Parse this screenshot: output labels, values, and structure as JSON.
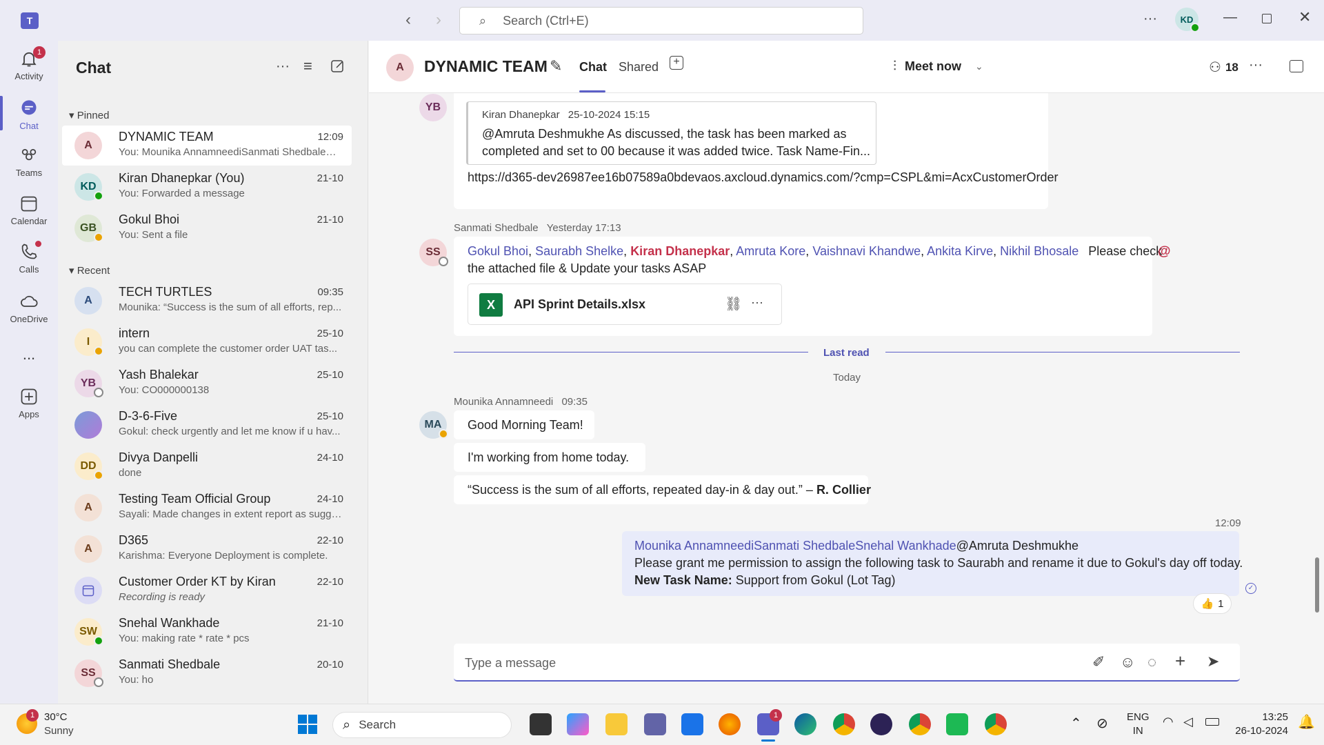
{
  "titlebar": {
    "search_placeholder": "Search (Ctrl+E)",
    "user_initials": "KD"
  },
  "rail": [
    {
      "label": "Activity",
      "badge": "1"
    },
    {
      "label": "Chat"
    },
    {
      "label": "Teams"
    },
    {
      "label": "Calendar"
    },
    {
      "label": "Calls"
    },
    {
      "label": "OneDrive"
    },
    {
      "label": "..."
    },
    {
      "label": "Apps"
    }
  ],
  "list": {
    "title": "Chat",
    "pinned_label": "Pinned",
    "recent_label": "Recent",
    "pinned": [
      {
        "initials": "A",
        "name": "DYNAMIC TEAM",
        "time": "12:09",
        "preview": "You: Mounika AnnamneediSanmati ShedbaleSn..."
      },
      {
        "initials": "KD",
        "name": "Kiran Dhanepkar (You)",
        "time": "21-10",
        "preview": "You: Forwarded a message"
      },
      {
        "initials": "GB",
        "name": "Gokul Bhoi",
        "time": "21-10",
        "preview": "You: Sent a file"
      }
    ],
    "recent": [
      {
        "initials": "A",
        "name": "TECH TURTLES",
        "time": "09:35",
        "preview": "Mounika: “Success is the sum of all efforts, rep..."
      },
      {
        "initials": "I",
        "name": "intern",
        "time": "25-10",
        "preview": "you can complete the customer order UAT  tas..."
      },
      {
        "initials": "YB",
        "name": "Yash Bhalekar",
        "time": "25-10",
        "preview": "You: CO000000138"
      },
      {
        "initials": "",
        "name": "D-3-6-Five",
        "time": "25-10",
        "preview": "Gokul: check urgently and let me know if u hav..."
      },
      {
        "initials": "DD",
        "name": "Divya Danpelli",
        "time": "24-10",
        "preview": "done"
      },
      {
        "initials": "A",
        "name": "Testing Team Official Group",
        "time": "24-10",
        "preview": "Sayali: Made changes in extent report as sugge..."
      },
      {
        "initials": "A",
        "name": "D365",
        "time": "22-10",
        "preview": "Karishma: Everyone  Deployment is complete."
      },
      {
        "initials": "",
        "name": "Customer Order KT by Kiran",
        "time": "22-10",
        "preview": "Recording is ready"
      },
      {
        "initials": "SW",
        "name": "Snehal Wankhade",
        "time": "21-10",
        "preview": "You: making rate  * rate * pcs"
      },
      {
        "initials": "SS",
        "name": "Sanmati Shedbale",
        "time": "20-10",
        "preview": "You: ho"
      }
    ]
  },
  "header": {
    "avatar": "A",
    "title": "DYNAMIC TEAM",
    "tab_chat": "Chat",
    "tab_shared": "Shared",
    "meet_now": "Meet now",
    "participants": "18"
  },
  "messages": {
    "quote_author": "Kiran Dhanepkar",
    "quote_time": "25-10-2024 15:15",
    "quote_text1": "@Amruta Deshmukhe As discussed, the task has been marked as",
    "quote_text2": "completed and set to 00 because it was added twice. Task Name-Fin...",
    "yb_link": "https://d365-dev26987ee16b07589a0bdevaos.axcloud.dynamics.com/?cmp=CSPL&mi=AcxCustomerOrder",
    "yb_initials": "YB",
    "ss_author": "Sanmati Shedbale",
    "ss_time": "Yesterday 17:13",
    "ss_initials": "SS",
    "ss_m1": "Gokul Bhoi",
    "ss_m2": "Saurabh Shelke",
    "ss_m3": "Kiran Dhanepkar",
    "ss_m4": "Amruta Kore",
    "ss_m5": "Vaishnavi Khandwe",
    "ss_m6": "Ankita Kirve",
    "ss_m7": "Nikhil Bhosale",
    "ss_text1": "Please check",
    "ss_text2": "the attached file & Update your tasks ASAP",
    "file_name": "API Sprint Details.xlsx",
    "last_read": "Last read",
    "today": "Today",
    "mo_author": "Mounika Annamneedi",
    "mo_time": "09:35",
    "mo_initials": "MA",
    "mo_m1": "Good Morning Team!",
    "mo_m2": "I'm working from home today.",
    "mo_m3": "“Success is the sum of all efforts, repeated day-in & day out.” –",
    "mo_m3b": "R. Collier",
    "my_time": "12:09",
    "my_line1_mentions": "Mounika AnnamneediSanmati ShedbaleSnehal Wankhade",
    "my_line1_rest": "@Amruta Deshmukhe",
    "my_line2": "Please grant me permission to assign the following task to Saurabh and rename it due to Gokul's day off today.",
    "my_line3_label": "New Task Name:",
    "my_line3_value": "Support from Gokul (Lot Tag)",
    "reaction_count": "1"
  },
  "compose": {
    "placeholder": "Type a message"
  },
  "taskbar": {
    "temp": "30°C",
    "weather": "Sunny",
    "weather_badge": "1",
    "search": "Search",
    "lang1": "ENG",
    "lang2": "IN",
    "time": "13:25",
    "date": "26-10-2024",
    "teams_badge": "1"
  }
}
